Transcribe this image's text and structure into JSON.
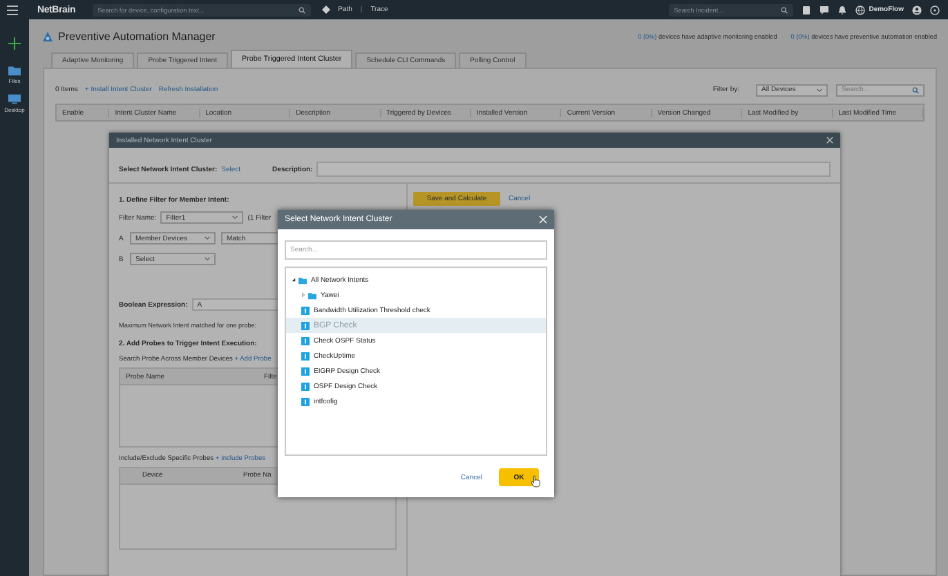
{
  "top_bar": {
    "logo": "NetBrain",
    "search": {
      "placeholder": "Search for device, configuration text..."
    },
    "path_label": "Path",
    "separator": "|",
    "trace_label": "Trace",
    "incident_search": {
      "placeholder": "Search Incident..."
    },
    "domain": "DemoFlow"
  },
  "left_rail": [
    {
      "label": "Files"
    },
    {
      "label": "Desktop"
    }
  ],
  "page": {
    "title": "Preventive Automation Manager",
    "stats": [
      {
        "count": "0 (0%)",
        "text": "devices have adaptive monitoring enabled"
      },
      {
        "count": "0 (0%)",
        "text": "devices have preventive automation enabled"
      }
    ]
  },
  "tabs": [
    {
      "label": "Adaptive Monitoring",
      "selected": false
    },
    {
      "label": "Probe Triggered Intent",
      "selected": false
    },
    {
      "label": "Probe Triggered Intent Cluster",
      "selected": true
    },
    {
      "label": "Schedule CLI Commands",
      "selected": false
    },
    {
      "label": "Polling Control",
      "selected": false
    }
  ],
  "toolbar": {
    "item_count": "0 Items",
    "actions": [
      "+ Install Intent Cluster",
      "Refresh Installation"
    ],
    "filter_label": "Filter by:",
    "filter_value": "All Devices",
    "search": {
      "placeholder": "Search..."
    }
  },
  "table": {
    "columns": [
      "Enable",
      "Intent Cluster Name",
      "Location",
      "Description",
      "Triggered by Devices",
      "Installed Version",
      "Current Version",
      "Version Changed",
      "Last Modified by",
      "Last Modified Time"
    ]
  },
  "install_dialog": {
    "title": "Installed Network Intent Cluster",
    "cluster_label": "Select Network Intent Cluster:",
    "cluster_link": "Select",
    "description_label": "Description:",
    "save_button": "Save and Calculate",
    "cancel_link": "Cancel",
    "section_1": "1. Define Filter for Member Intent:",
    "filter_name_label": "Filter Name:",
    "filter_name": "Filter1",
    "filter_count": "(1 Filter",
    "conditions": [
      {
        "letter": "A",
        "field": "Member Devices",
        "operator": "Match"
      },
      {
        "letter": "B",
        "field": "Select"
      }
    ],
    "boolean_label": "Boolean Expression:",
    "boolean_value": "A",
    "max_label": "Maximum Network Intent matched for one probe:",
    "section_2": "2. Add Probes to Trigger Intent Execution:",
    "probe_search_label": "Search Probe Across Member Devices",
    "add_probe_link": "+ Add Probe",
    "probe_columns": [
      "Probe Name",
      "Filte"
    ],
    "include_label": "Include/Exclude Specific Probes",
    "include_link": "+ Include Probes",
    "include_columns": [
      "Device",
      "Probe Na"
    ]
  },
  "select_dialog": {
    "title": "Select Network Intent Cluster",
    "search": {
      "placeholder": "Search..."
    },
    "tree": [
      {
        "kind": "folder",
        "label": "All Network Intents",
        "expanded": true,
        "selected": false,
        "children": [
          {
            "kind": "folder",
            "label": "Yawei",
            "expanded": false,
            "selected": false
          },
          {
            "kind": "intent",
            "label": "Bandwidth Utilization Threshold check",
            "selected": false
          },
          {
            "kind": "intent",
            "label": "BGP Check",
            "selected": true
          },
          {
            "kind": "intent",
            "label": "Check OSPF Status",
            "selected": false
          },
          {
            "kind": "intent",
            "label": "CheckUptime",
            "selected": false
          },
          {
            "kind": "intent",
            "label": "EIGRP Design Check",
            "selected": false
          },
          {
            "kind": "intent",
            "label": "OSPF Design Check",
            "selected": false
          },
          {
            "kind": "intent",
            "label": "intfcofig",
            "selected": false
          }
        ]
      }
    ],
    "cancel_button": "Cancel",
    "ok_button": "OK"
  }
}
